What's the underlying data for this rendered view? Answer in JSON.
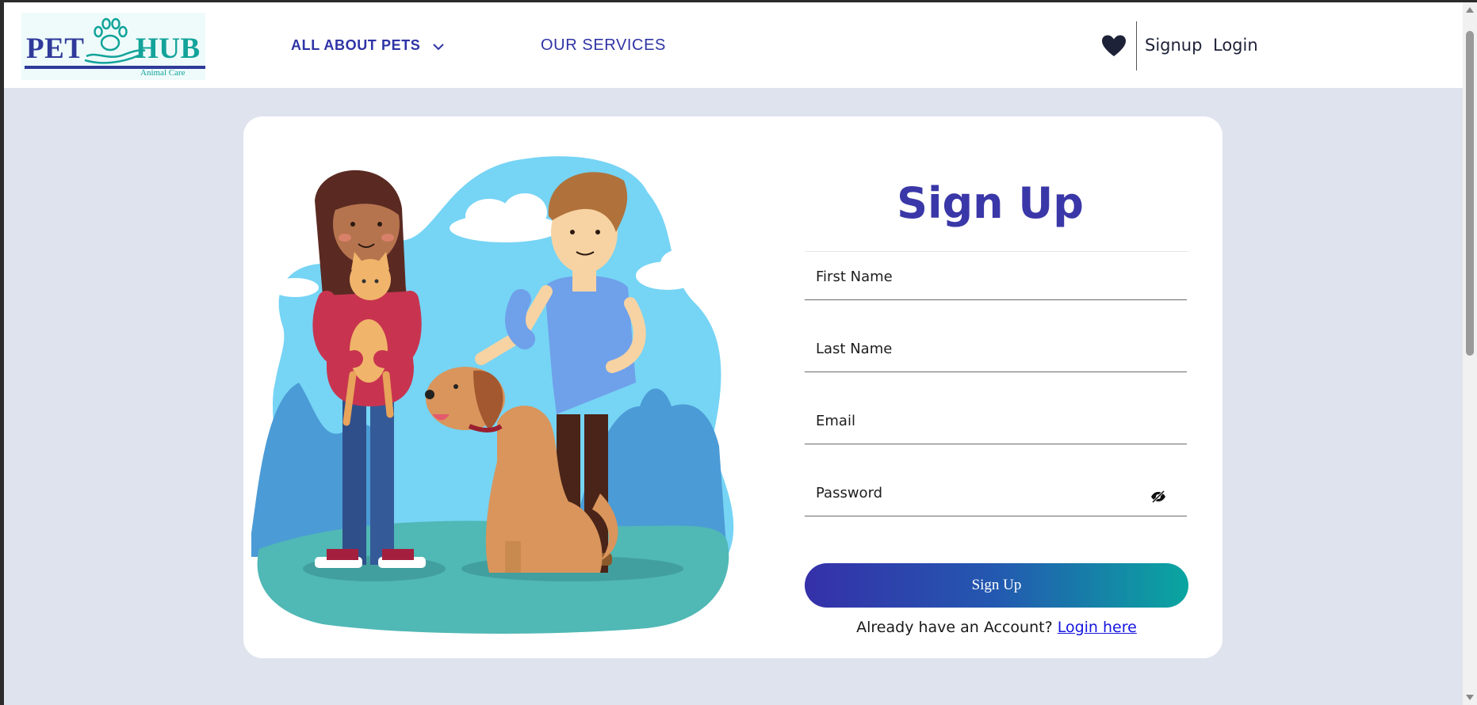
{
  "header": {
    "logo": {
      "brand_left": "PET",
      "brand_right": "HUB",
      "tagline": "Animal Care"
    },
    "nav": {
      "all_about_pets": "ALL ABOUT PETS",
      "our_services": "OUR SERVICES"
    },
    "favorites_icon": "heart-icon",
    "signup_link": "Signup",
    "login_link": "Login"
  },
  "form": {
    "title": "Sign Up",
    "first_name": {
      "placeholder": "First Name",
      "value": ""
    },
    "last_name": {
      "placeholder": "Last Name",
      "value": ""
    },
    "email": {
      "placeholder": "Email",
      "value": ""
    },
    "password": {
      "placeholder": "Password",
      "value": "",
      "toggle_icon": "eye-slash-icon"
    },
    "submit_label": "Sign Up",
    "account_prompt": "Already have an Account?",
    "login_here": "Login here"
  },
  "colors": {
    "brand_primary": "#3a37a8",
    "brand_teal": "#0aa6a0",
    "page_background": "#dfe3ee"
  }
}
